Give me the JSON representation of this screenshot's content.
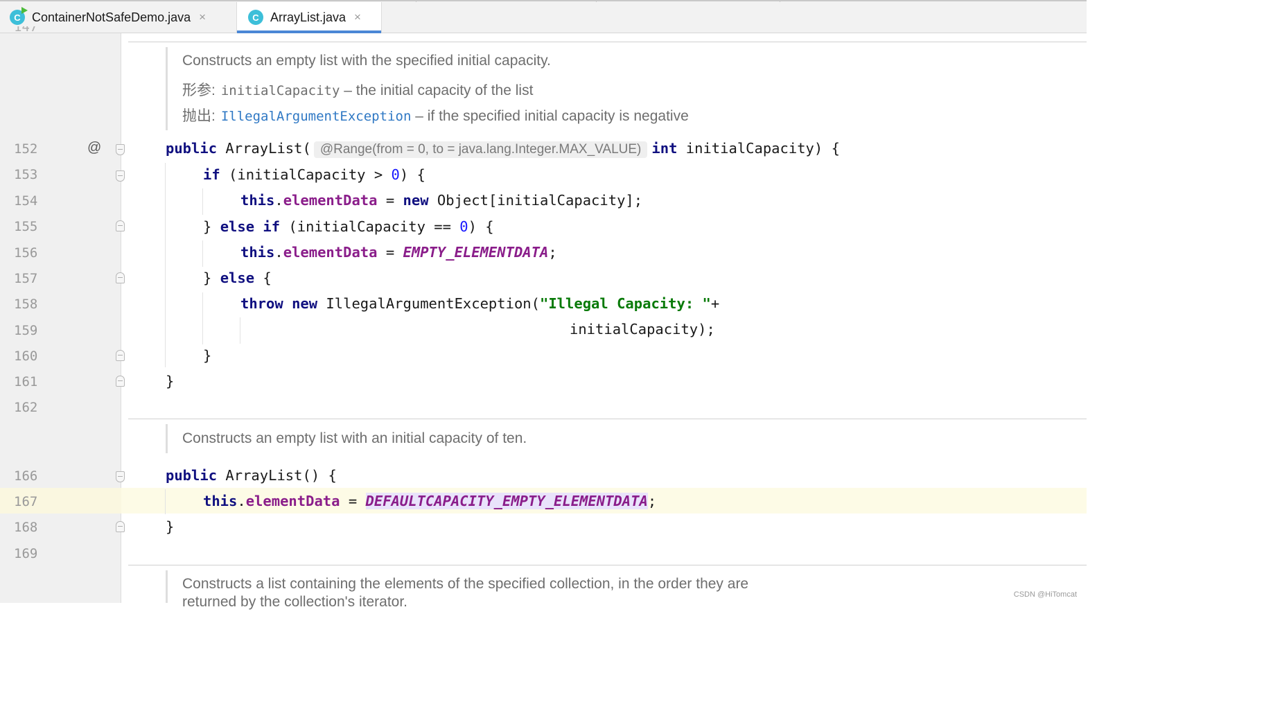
{
  "tabs": [
    {
      "label": "ContainerNotSafeDemo.java",
      "icon": "C",
      "close": "×"
    },
    {
      "label": "ArrayList.java",
      "icon": "C",
      "close": "×"
    }
  ],
  "gutter": {
    "annotation_mark": "@",
    "line_numbers": [
      "152",
      "153",
      "154",
      "155",
      "156",
      "157",
      "158",
      "159",
      "160",
      "161",
      "162",
      "166",
      "167",
      "168",
      "169"
    ]
  },
  "docs": {
    "doc1": {
      "line1": "Constructs an empty list with the specified initial capacity.",
      "param_label": "形参:",
      "param_name": "initialCapacity",
      "param_desc": " – the initial capacity of the list",
      "throws_label": "抛出:",
      "throws_name": "IllegalArgumentException",
      "throws_desc": " – if the specified initial capacity is negative"
    },
    "doc2": {
      "line1": "Constructs an empty list with an initial capacity of ten."
    },
    "doc3": {
      "line1": "Constructs a list containing the elements of the specified collection, in the order they are",
      "line2": "returned by the collection's iterator."
    }
  },
  "code": {
    "l152": {
      "kw1": "public",
      "sig": " ArrayList(",
      "hint": "@Range(from = 0, to = java.lang.Integer.MAX_VALUE)",
      "kw2": "int",
      "rest": " initialCapacity) {"
    },
    "l153": {
      "kw": "if",
      "t1": " (initialCapacity > ",
      "num": "0",
      "t2": ") {"
    },
    "l154": {
      "kw1": "this",
      "dot": ".",
      "fld": "elementData",
      "t1": " = ",
      "kw2": "new",
      "t2": " Object[initialCapacity];"
    },
    "l155": {
      "t0": "} ",
      "kw1": "else",
      "sp": " ",
      "kw2": "if",
      "t1": " (initialCapacity == ",
      "num": "0",
      "t2": ") {"
    },
    "l156": {
      "kw1": "this",
      "dot": ".",
      "fld": "elementData",
      "t1": " = ",
      "cst": "EMPTY_ELEMENTDATA",
      "t2": ";"
    },
    "l157": {
      "t0": "} ",
      "kw": "else",
      "t1": " {"
    },
    "l158": {
      "kw1": "throw",
      "sp": " ",
      "kw2": "new",
      "t1": " IllegalArgumentException(",
      "str": "\"Illegal Capacity: \"",
      "t2": "+"
    },
    "l159": {
      "t1": "initialCapacity);"
    },
    "l160": {
      "t1": "}"
    },
    "l161": {
      "t1": "}"
    },
    "l166": {
      "kw": "public",
      "t1": " ArrayList() {"
    },
    "l167": {
      "kw1": "this",
      "dot": ".",
      "fld": "elementData",
      "t1": " = ",
      "cst": "DEFAULTCAPACITY_EMPTY_ELEMENTDATA",
      "t2": ";"
    },
    "l168": {
      "t1": "}"
    }
  },
  "watermark": "CSDN @HiTomcat",
  "colors": {
    "keyword": "#101080",
    "field": "#8a1d8a",
    "number": "#1717ff",
    "string": "#087a08",
    "link": "#2f78c4",
    "tab_underline": "#4a87d6",
    "current_line": "#fdfbe6"
  }
}
